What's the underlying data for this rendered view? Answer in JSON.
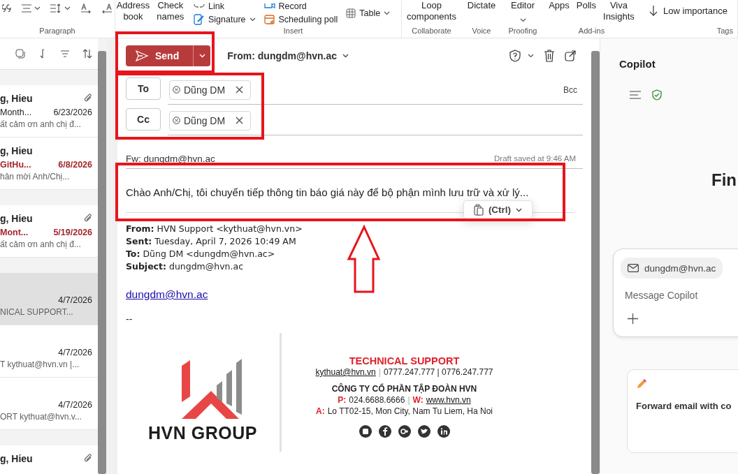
{
  "ribbon": {
    "groups": [
      {
        "kind": "paragraph",
        "label": "Paragraph"
      },
      {
        "kind": "large",
        "buttons": [
          {
            "label": "Address book",
            "dropdown": false
          },
          {
            "label": "Check names",
            "dropdown": false
          }
        ]
      },
      {
        "kind": "insert",
        "label": "Insert",
        "buttons": [
          {
            "label": "Link",
            "dropdown": false
          },
          {
            "label": "Signature",
            "dropdown": true
          },
          {
            "label": "Record",
            "dropdown": false
          },
          {
            "label": "Scheduling poll",
            "dropdown": false
          },
          {
            "label": "Table",
            "dropdown": true
          }
        ]
      },
      {
        "kind": "large",
        "label": "Collaborate",
        "buttons": [
          {
            "label": "Loop components",
            "dropdown": false
          }
        ]
      },
      {
        "kind": "large",
        "label": "Voice",
        "buttons": [
          {
            "label": "Dictate",
            "dropdown": false
          }
        ]
      },
      {
        "kind": "large",
        "label": "Proofing",
        "buttons": [
          {
            "label": "Editor",
            "dropdown": true
          }
        ]
      },
      {
        "kind": "large",
        "label": "Add-ins",
        "buttons": [
          {
            "label": "Apps",
            "dropdown": false
          },
          {
            "label": "Polls",
            "dropdown": false
          },
          {
            "label": "Viva Insights",
            "dropdown": false
          }
        ]
      },
      {
        "kind": "tags",
        "label": "Tags",
        "buttons": [
          {
            "label": "Low importance",
            "dropdown": false
          }
        ]
      }
    ]
  },
  "message_groups": [
    {
      "messages": [
        {
          "sender": "g, Hieu",
          "subject": "Month...",
          "date": "6/23/2026",
          "preview": "ất cảm ơn anh chị đ...",
          "attachment": true,
          "highlighted": false,
          "selected": false
        },
        {
          "sender": "g, Hieu",
          "subject": "GitHu...",
          "date": "6/8/2026",
          "preview": "hân mời Anh/Chị...",
          "attachment": false,
          "highlighted": true,
          "selected": false
        }
      ]
    },
    {
      "messages": [
        {
          "sender": "g, Hieu",
          "subject": "Mont...",
          "date": "5/19/2026",
          "preview": "ất cảm ơn anh chị đ...",
          "attachment": true,
          "highlighted": true,
          "selected": false
        }
      ]
    },
    {
      "messages": [
        {
          "date": "4/7/2026",
          "preview": "NICAL SUPPORT...",
          "attachment": false,
          "selected": true
        },
        {
          "date": "4/7/2026",
          "preview": "T kythuat@hvn.vn |...",
          "attachment": false,
          "selected": false
        },
        {
          "date": "4/7/2026",
          "preview": "ORT kythuat@hvn.v...",
          "attachment": false,
          "selected": false
        }
      ]
    },
    {
      "messages": [
        {
          "sender": "g, Hieu",
          "attachment": true,
          "selected": false
        }
      ]
    }
  ],
  "compose": {
    "send": "Send",
    "from": "From: dungdm@hvn.ac",
    "recipients": [
      {
        "label": "To",
        "chips": [
          "Dũng DM"
        ],
        "extra": "Bcc"
      },
      {
        "label": "Cc",
        "chips": [
          "Dũng DM"
        ]
      }
    ],
    "subject": "Fw: dungdm@hvn.ac",
    "draft_status": "Draft saved at 9:46 AM",
    "body": "Chào Anh/Chị, tôi chuyển tiếp thông tin báo giá này để bộ phận mình lưu trữ và xử lý...",
    "paste_button": "(Ctrl)",
    "quoted_header": [
      "**From:** HVN Support <kythuat@hvn.vn>",
      "**Sent:** Tuesday, April 7, 2026 10:49 AM",
      "**To:** Dũng DM <dungdm@hvn.ac>",
      "**Subject:** dungdm@hvn.ac"
    ],
    "link": "dungdm@hvn.ac",
    "separator": "--",
    "signature": {
      "logo_text": "HVN GROUP",
      "title": "TECHNICAL SUPPORT",
      "lines": [
        [
          {
            "kind": "link",
            "text": "kythuat@hvn.vn"
          },
          {
            "kind": "sep",
            "text": "|"
          },
          {
            "kind": "text",
            "text": "0777.247.777 | 0776.247.777"
          }
        ],
        [
          {
            "kind": "strong",
            "text": "CÔNG TY CỔ PHẦN TẬP ĐOÀN HVN"
          }
        ],
        [
          {
            "kind": "label",
            "text": "P:"
          },
          {
            "kind": "text",
            "text": "024.6688.6666"
          },
          {
            "kind": "sep",
            "text": "|"
          },
          {
            "kind": "label",
            "text": "W:"
          },
          {
            "kind": "link",
            "text": "www.hvn.vn"
          }
        ],
        [
          {
            "kind": "label",
            "text": "A:"
          },
          {
            "kind": "text",
            "text": "Lo TT02-15, Mon City, Nam Tu Liem, Ha Noi"
          }
        ]
      ]
    }
  },
  "copilot": {
    "title": "Copilot",
    "heading": "Fin",
    "context_chip": "dungdm@hvn.ac",
    "placeholder": "Message Copilot",
    "suggestion": "Forward email with co"
  }
}
